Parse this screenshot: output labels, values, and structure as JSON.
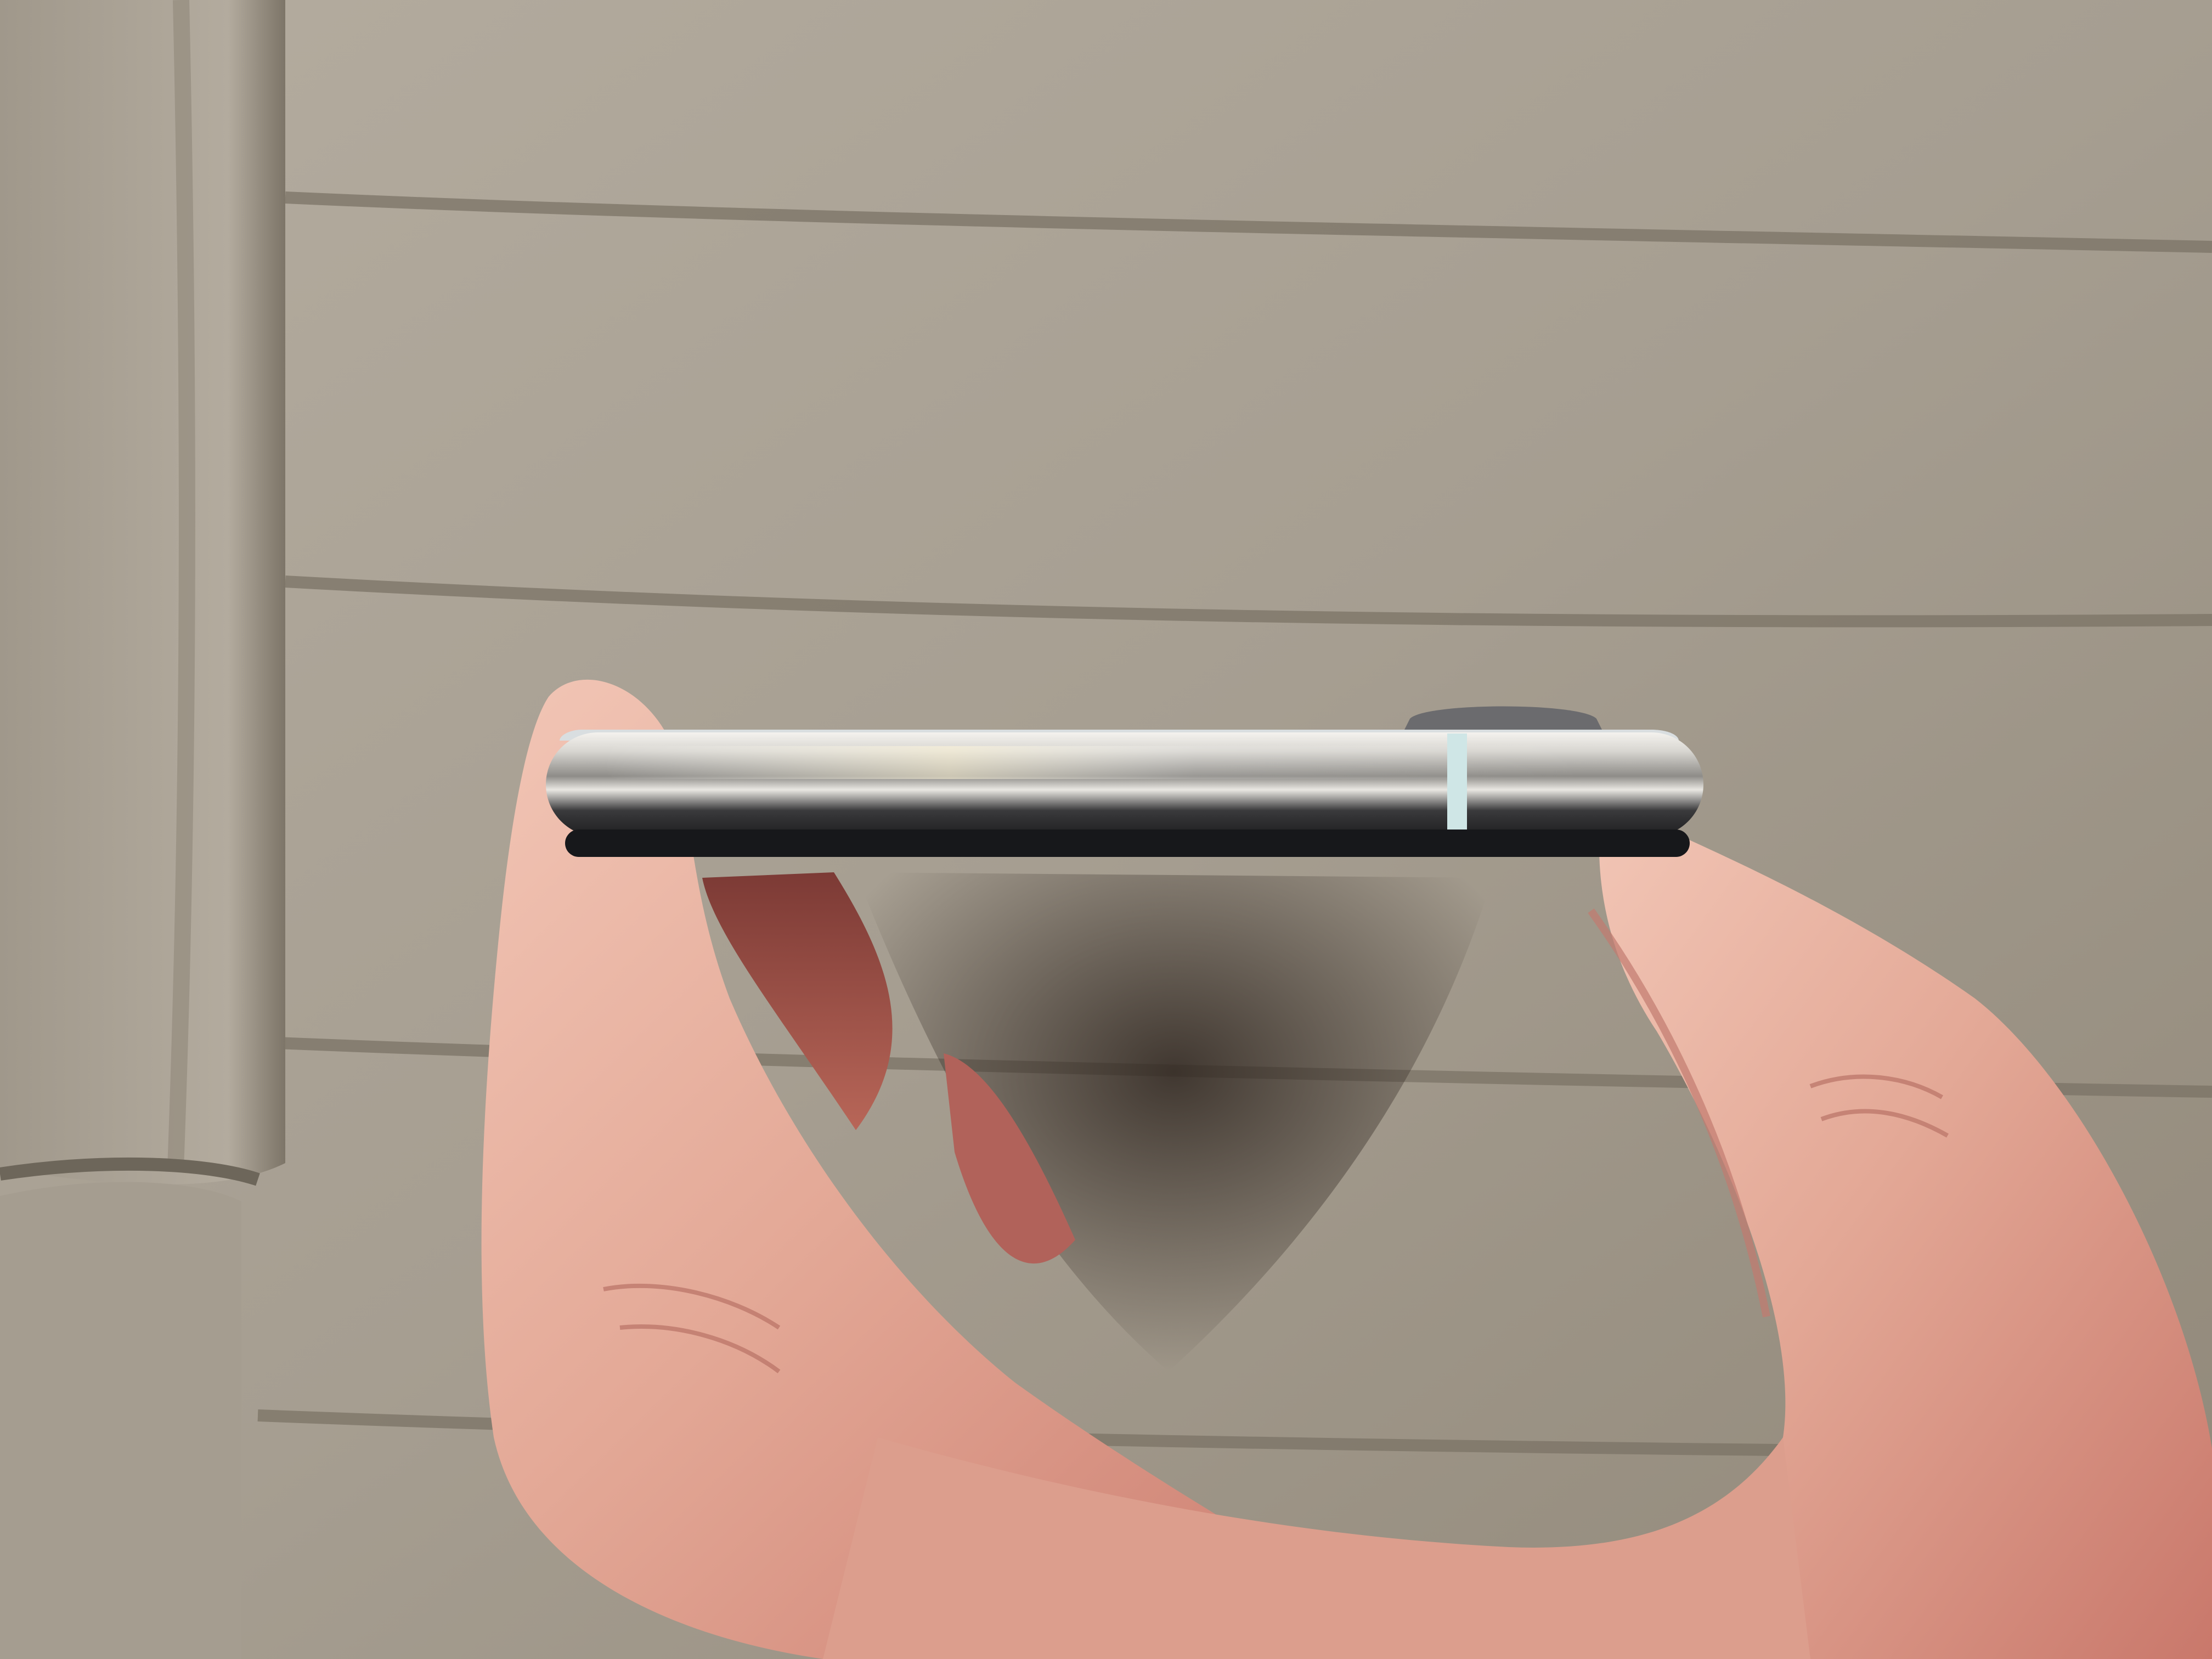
{
  "scene": {
    "subject": "phone-edge-held-in-hand",
    "colors": {
      "fabric_light": "#b9b1a4",
      "fabric_mid": "#9d9587",
      "fabric_dark": "#6f675b",
      "cushion": "#aaa295",
      "shadow": "#3a2f27",
      "skin_light": "#f0c3b2",
      "skin_mid": "#d89384",
      "skin_dark": "#9a4f45",
      "steel_light": "#f4f2ee",
      "steel_mid": "#b8b6b2",
      "steel_dark": "#242426",
      "glass_back": "#d9dee0",
      "antenna_band": "#cfe6e6",
      "camera_bump": "#6b6b6e"
    }
  }
}
